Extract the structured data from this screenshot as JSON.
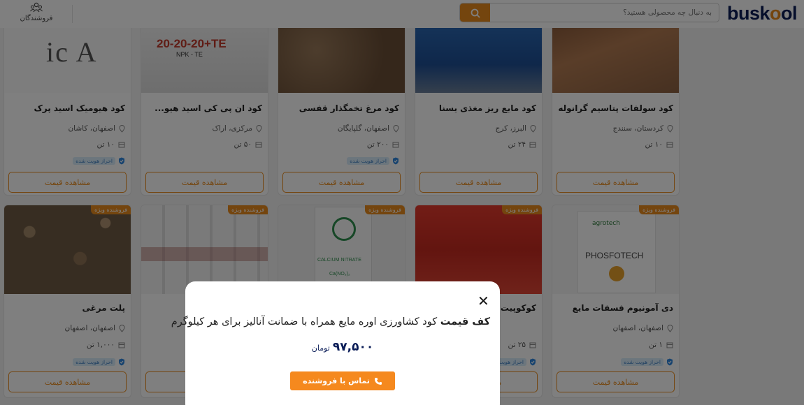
{
  "header": {
    "logo_main": "busk",
    "logo_o": "o",
    "logo_tail": "ol",
    "search_placeholder": "به دنبال چه محصولی هستید؟",
    "sellers_label": "فروشندگان",
    "icons": {
      "search": "search-icon",
      "sellers": "users-icon"
    }
  },
  "products_row1": [
    {
      "title": "کود سولفات پتاسیم گرانوله",
      "location": "کردستان، سنندج",
      "qty": "۱۰ تن",
      "verified": false,
      "button": "مشاهده قیمت"
    },
    {
      "title": "کود مایع ریز مغذی یسنا",
      "location": "البرز، کرج",
      "qty": "۲۴ تن",
      "verified": false,
      "button": "مشاهده قیمت"
    },
    {
      "title": "کود مرغ تخمگذار قفسی",
      "location": "اصفهان، گلپایگان",
      "qty": "۲۰۰ تن",
      "verified": true,
      "verified_label": "احراز هویت شده",
      "button": "مشاهده قیمت"
    },
    {
      "title": "کود ان پی کی اسید هیو...",
      "location": "مرکزی، اراک",
      "qty": "۵۰ تن",
      "verified": false,
      "button": "مشاهده قیمت"
    },
    {
      "title": "کود هیومیک اسید پرک",
      "location": "اصفهان، کاشان",
      "qty": "۱۰ تن",
      "verified": true,
      "verified_label": "احراز هویت شده",
      "button": "مشاهده قیمت"
    }
  ],
  "products_row2": [
    {
      "badge": "فروشنده ویژه",
      "title": "دی آمونیوم فسفات مایع",
      "location": "اصفهان، اصفهان",
      "qty": "۱ تن",
      "verified": true,
      "verified_label": "احراز هویت شده",
      "button": "مشاهده قیمت"
    },
    {
      "badge": "فروشنده ویژه",
      "title": "کوکوپیت",
      "location": "",
      "qty": "۲۵ تن",
      "verified": true,
      "verified_label": "احراز هویت شده",
      "button": "مشاهده قیمت"
    },
    {
      "badge": "فروشنده ویژه",
      "title": "",
      "location": "",
      "qty": "",
      "verified": false,
      "button": ""
    },
    {
      "badge": "فروشنده ویژه",
      "title": "",
      "location": "",
      "qty": "",
      "verified": false,
      "button": ""
    },
    {
      "badge": "فروشنده ویژه",
      "title": "پلت مرغی",
      "location": "اصفهان، اصفهان",
      "qty": "۱,۰۰۰ تن",
      "verified": true,
      "verified_label": "احراز هویت شده",
      "button": "مشاهده قیمت"
    }
  ],
  "product_images": {
    "row2_col3_text_top": "PHOSFOTECH",
    "row2_col3_logo": "agrotech",
    "row2_col1_text": "CALCIUM NITRATE",
    "row2_col1_formula": "Ca(NO₃)₂",
    "row1_col4_text": "20-20-20+TE",
    "row1_col4_sub": "NPK - TE",
    "row1_col5_text": "ic A"
  },
  "modal": {
    "title_bold": "کف قیمت",
    "title_rest": " کود کشاورزی اوره مایع همراه با ضمانت آنالیز برای هر کیلوگرم",
    "price": "۹۷,۵۰۰",
    "currency": "تومان",
    "contact_label": "تماس با فروشنده",
    "close_icon": "close-icon",
    "phone_icon": "phone-icon"
  },
  "colors": {
    "accent": "#e98b1d",
    "brand_navy": "#0a1c57",
    "verified_blue": "#2e86de"
  }
}
